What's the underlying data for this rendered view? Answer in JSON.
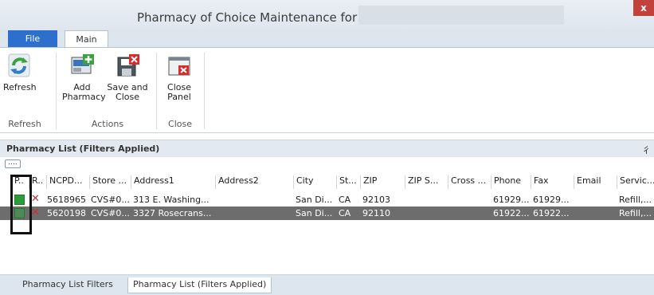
{
  "window": {
    "title": "Pharmacy of Choice Maintenance for",
    "close_label": "x"
  },
  "ribbon": {
    "tabs": [
      {
        "label": "File"
      },
      {
        "label": "Main"
      }
    ],
    "buttons": {
      "refresh": "Refresh",
      "add_pharmacy_1": "Add",
      "add_pharmacy_2": "Pharmacy",
      "save_close_1": "Save and",
      "save_close_2": "Close",
      "close_panel_1": "Close",
      "close_panel_2": "Panel"
    },
    "groups": {
      "refresh": "Refresh",
      "actions": "Actions",
      "close": "Close"
    }
  },
  "panel": {
    "title": "Pharmacy List (Filters Applied)",
    "pin": "⼻",
    "filter_button": "....",
    "columns": [
      "P..",
      "R..",
      "NCPD...",
      "Store ...",
      "Address1",
      "Address2",
      "City",
      "St...",
      "ZIP",
      "ZIP S...",
      "Cross ...",
      "Phone",
      "Fax",
      "Email",
      "Servic..."
    ],
    "rows": [
      {
        "ncpdp": "5618965",
        "store": "CVS#0...",
        "address1": "313 E. Washing...",
        "address2": "",
        "city": "San Di...",
        "state": "CA",
        "zip": "92103",
        "zip_suffix": "",
        "cross": "",
        "phone": "61929...",
        "fax": "61929...",
        "email": "",
        "service": "Refill,..."
      },
      {
        "ncpdp": "5620198",
        "store": "CVS#0...",
        "address1": "3327 Rosecrans...",
        "address2": "",
        "city": "San Di...",
        "state": "CA",
        "zip": "92110",
        "zip_suffix": "",
        "cross": "",
        "phone": "61922...",
        "fax": "61922...",
        "email": "",
        "service": "Refill,..."
      }
    ]
  },
  "bottom_tabs": [
    {
      "label": "Pharmacy List Filters"
    },
    {
      "label": "Pharmacy List (Filters Applied)"
    }
  ],
  "colors": {
    "file_tab": "#2d6fcc",
    "selected_row": "#6d6d6d",
    "check": "#2e9a3a",
    "remove": "#d52c2c"
  }
}
